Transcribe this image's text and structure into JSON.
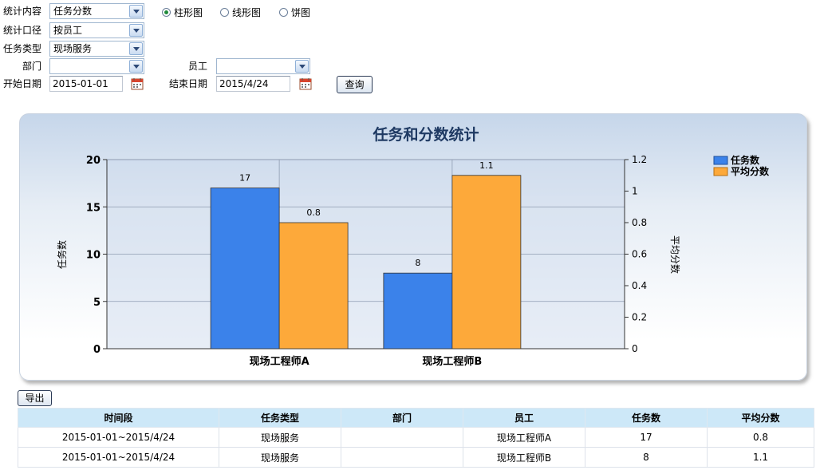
{
  "filters": {
    "stat_content": {
      "label": "统计内容",
      "value": "任务分数"
    },
    "stat_scope": {
      "label": "统计口径",
      "value": "按员工"
    },
    "task_type": {
      "label": "任务类型",
      "value": "现场服务"
    },
    "department": {
      "label": "部门",
      "value": ""
    },
    "employee": {
      "label": "员工",
      "value": ""
    },
    "start_date": {
      "label": "开始日期",
      "value": "2015-01-01"
    },
    "end_date": {
      "label": "结束日期",
      "value": "2015/4/24"
    },
    "query_label": "查询",
    "chart_types": [
      {
        "label": "柱形图",
        "selected": true
      },
      {
        "label": "线形图",
        "selected": false
      },
      {
        "label": "饼图",
        "selected": false
      }
    ]
  },
  "chart_data": {
    "type": "bar",
    "title": "任务和分数统计",
    "categories": [
      "现场工程师A",
      "现场工程师B"
    ],
    "series": [
      {
        "name": "任务数",
        "values": [
          17,
          8
        ],
        "color": "#3b82ea",
        "axis": "left"
      },
      {
        "name": "平均分数",
        "values": [
          0.8,
          1.1
        ],
        "color": "#fda93a",
        "axis": "right"
      }
    ],
    "ylabel": "任务数",
    "ylim": [
      0,
      20
    ],
    "yticks": [
      0,
      5,
      10,
      15,
      20
    ],
    "y2label": "平均分数",
    "y2lim": [
      0,
      1.2
    ],
    "y2ticks": [
      "0",
      "0.2",
      "0.4",
      "0.6",
      "0.8",
      "1",
      "1.2"
    ],
    "grid": true,
    "legend": "top-right"
  },
  "export_label": "导出",
  "table": {
    "headers": [
      "时间段",
      "任务类型",
      "部门",
      "员工",
      "任务数",
      "平均分数"
    ],
    "rows": [
      [
        "2015-01-01~2015/4/24",
        "现场服务",
        "",
        "现场工程师A",
        "17",
        "0.8"
      ],
      [
        "2015-01-01~2015/4/24",
        "现场服务",
        "",
        "现场工程师B",
        "8",
        "1.1"
      ]
    ]
  },
  "colors": {
    "accent": "#1f3a63",
    "header_bg": "#cde8f8"
  }
}
